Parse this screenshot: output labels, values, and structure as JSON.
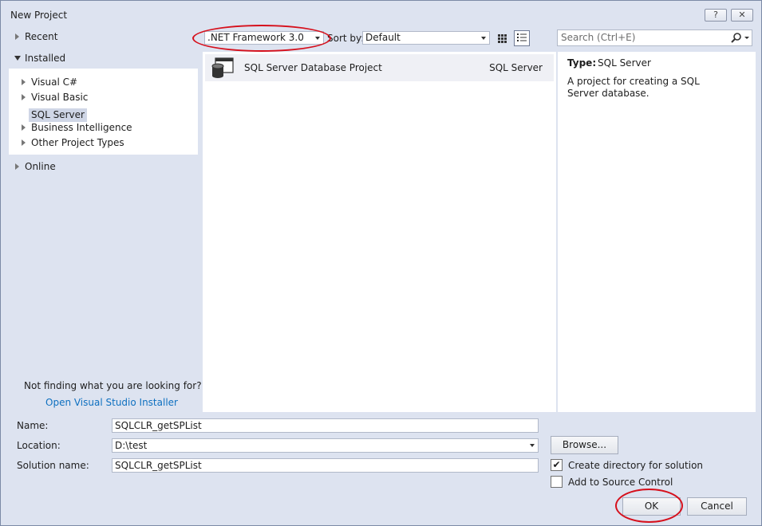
{
  "window": {
    "title": "New Project"
  },
  "titlebar_buttons": {
    "help": "?",
    "close": "✕"
  },
  "tree": {
    "recent": "Recent",
    "installed": "Installed",
    "items": [
      "Visual C#",
      "Visual Basic",
      "SQL Server",
      "Business Intelligence",
      "Other Project Types"
    ],
    "selected": "SQL Server",
    "online": "Online"
  },
  "not_finding": {
    "text": "Not finding what you are looking for?",
    "link": "Open Visual Studio Installer"
  },
  "toolbar": {
    "framework": ".NET Framework 3.0",
    "sort_label": "Sort by:",
    "sort_value": "Default",
    "search_placeholder": "Search (Ctrl+E)"
  },
  "templates": [
    {
      "name": "SQL Server Database Project",
      "language": "SQL Server",
      "icon": "database-icon"
    }
  ],
  "description": {
    "type_label": "Type:",
    "type_value": "SQL Server",
    "text": "A project for creating a SQL Server database."
  },
  "form": {
    "name_label": "Name:",
    "name_value": "SQLCLR_getSPList",
    "location_label": "Location:",
    "location_value": "D:\\test",
    "solution_label": "Solution name:",
    "solution_value": "SQLCLR_getSPList",
    "browse": "Browse...",
    "create_dir": "Create directory for solution",
    "create_dir_checked": true,
    "add_source": "Add to Source Control",
    "add_source_checked": false,
    "ok": "OK",
    "cancel": "Cancel"
  },
  "annotation_color": "#d6101c"
}
